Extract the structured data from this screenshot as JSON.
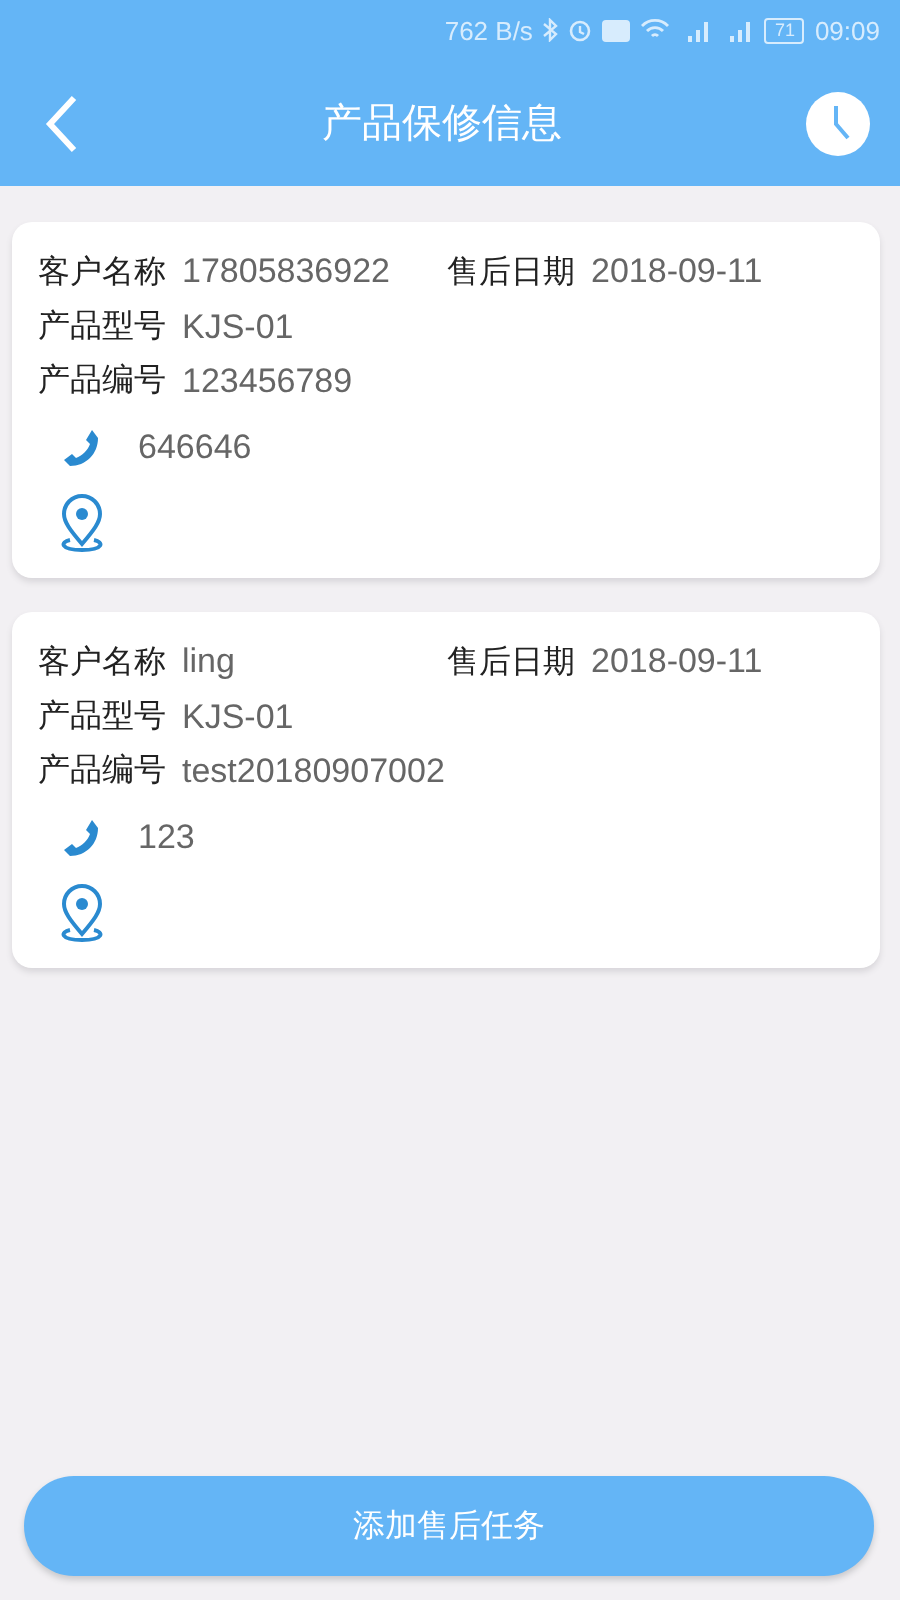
{
  "status_bar": {
    "speed": "762 B/s",
    "battery": "71",
    "time": "09:09"
  },
  "header": {
    "title": "产品保修信息"
  },
  "records": [
    {
      "customer_label": "客户名称",
      "customer": "17805836922",
      "date_label": "售后日期",
      "date": "2018-09-11",
      "model_label": "产品型号",
      "model": "KJS-01",
      "serial_label": "产品编号",
      "serial": "123456789",
      "phone": "646646"
    },
    {
      "customer_label": "客户名称",
      "customer": "ling",
      "date_label": "售后日期",
      "date": "2018-09-11",
      "model_label": "产品型号",
      "model": "KJS-01",
      "serial_label": "产品编号",
      "serial": "test20180907002",
      "phone": "123"
    }
  ],
  "add_button": "添加售后任务"
}
